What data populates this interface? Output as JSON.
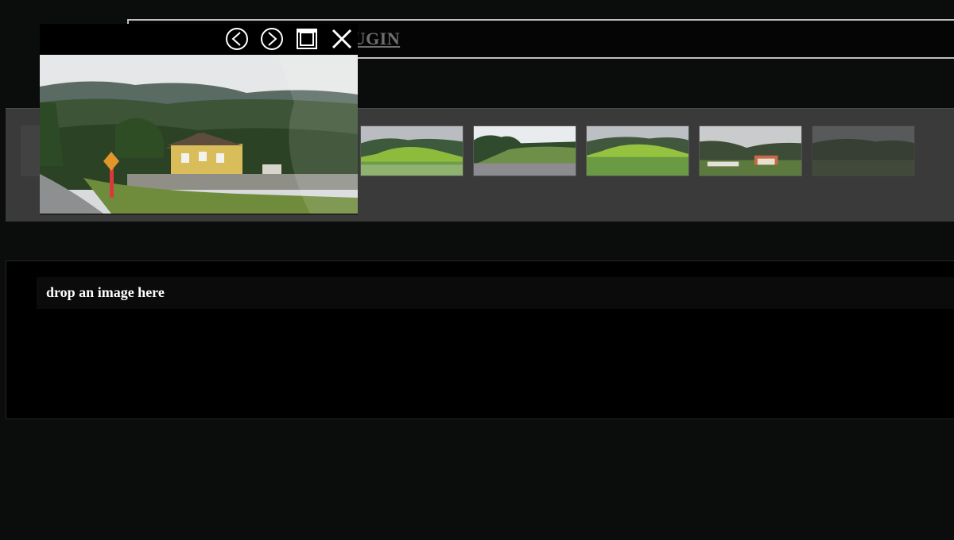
{
  "header": {
    "title": "JQUERY GALLERY PLUGIN"
  },
  "preview": {
    "controls": [
      {
        "name": "prev-icon"
      },
      {
        "name": "next-icon"
      },
      {
        "name": "window-icon"
      },
      {
        "name": "close-icon"
      }
    ]
  },
  "gallery": {
    "thumbnails": [
      {
        "name": "thumb-ghost-left"
      },
      {
        "name": "thumb-hills-meadow"
      },
      {
        "name": "thumb-road-trees"
      },
      {
        "name": "thumb-green-hill"
      },
      {
        "name": "thumb-village-houses"
      },
      {
        "name": "thumb-faded-right"
      }
    ]
  },
  "dropzone": {
    "label": "drop an image here"
  },
  "colors": {
    "background": "#0b0c0c",
    "panel": "#3a3a3a",
    "header_border": "#bfbfbf",
    "title": "#6f6f6f",
    "drop_text": "#ffffff"
  }
}
